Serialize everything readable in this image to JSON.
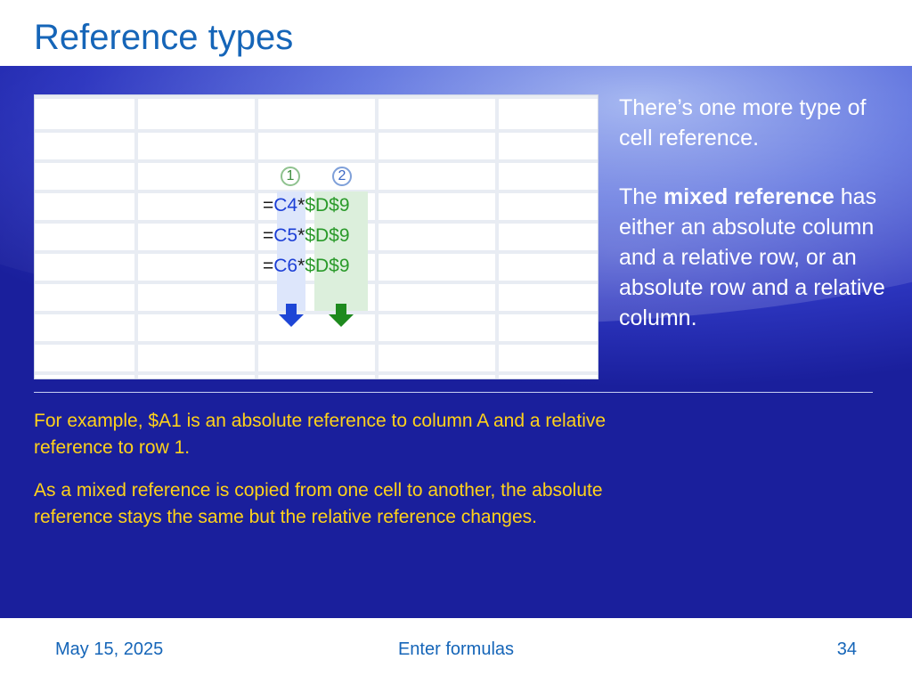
{
  "slide": {
    "title": "Reference types",
    "sheet": {
      "circle_1": "1",
      "circle_2": "2",
      "formulas": [
        {
          "eq": "=",
          "rel": "C4",
          "op": "*",
          "abs": "$D$9"
        },
        {
          "eq": "=",
          "rel": "C5",
          "op": "*",
          "abs": "$D$9"
        },
        {
          "eq": "=",
          "rel": "C6",
          "op": "*",
          "abs": "$D$9"
        }
      ]
    },
    "side_text_1": "There’s one more type of cell reference.",
    "side_text_2_prefix": "The ",
    "side_text_2_bold": "mixed reference",
    "side_text_2_rest": " has either an absolute column and a relative row, or an absolute row and a relative column.",
    "example_1": "For example, $A1 is an absolute reference to column A and a relative reference to row 1.",
    "example_2": "As a mixed reference is copied from one cell to another, the absolute reference stays the same but the relative reference changes."
  },
  "footer": {
    "date": "May 15, 2025",
    "center": "Enter formulas",
    "page": "34"
  },
  "colors": {
    "title": "#1565b8",
    "example_text": "#ffd21a",
    "relative_ref": "#1c3fd6",
    "absolute_ref": "#2a9a2a"
  }
}
